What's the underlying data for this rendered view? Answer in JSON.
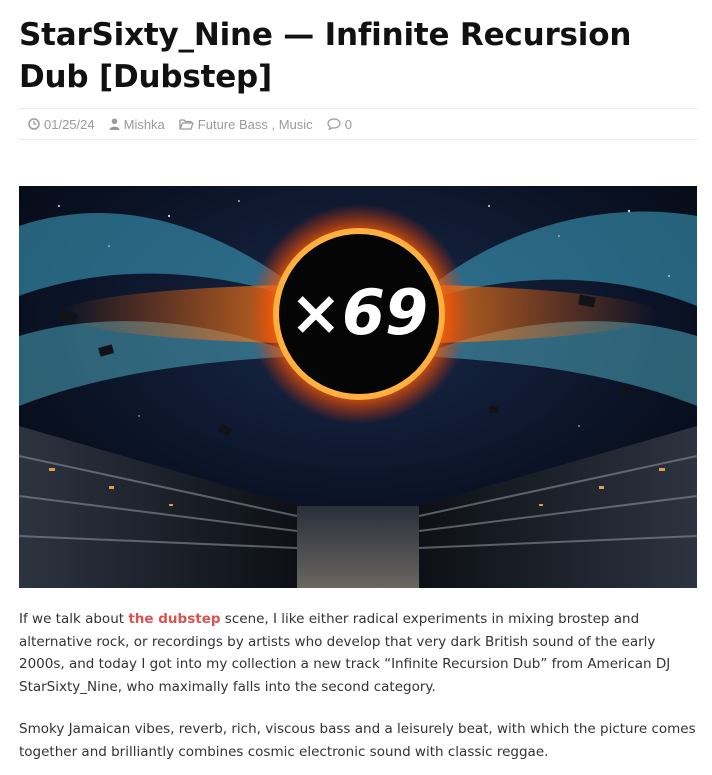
{
  "post": {
    "title": "StarSixty_Nine — Infinite Recursion Dub [Dubstep]",
    "meta": {
      "date": "01/25/24",
      "author": "Mishka",
      "categories": [
        "Future Bass",
        "Music"
      ],
      "category_separator": " , ",
      "comments": "0"
    },
    "hero": {
      "logo_text": "×69",
      "icon": "album-art-black-hole-image"
    },
    "paragraphs": [
      {
        "before": "If we talk about ",
        "link": "the dubstep",
        "after": " scene, I like either radical experiments in mixing brostep and alternative rock, or recordings by artists who develop that very dark British sound of the early 2000s, and today I got into my collection a new track “Infinite Recursion Dub” from American DJ StarSixty_Nine, who maximally falls into the second category."
      },
      {
        "text": "Smoky Jamaican vibes, reverb, rich, viscous bass and a leisurely beat, with which the picture comes together and brilliantly combines cosmic electronic sound with classic reggae."
      }
    ]
  },
  "colors": {
    "link_accent": "#d9534f",
    "meta_gray": "#9a9a9a"
  }
}
